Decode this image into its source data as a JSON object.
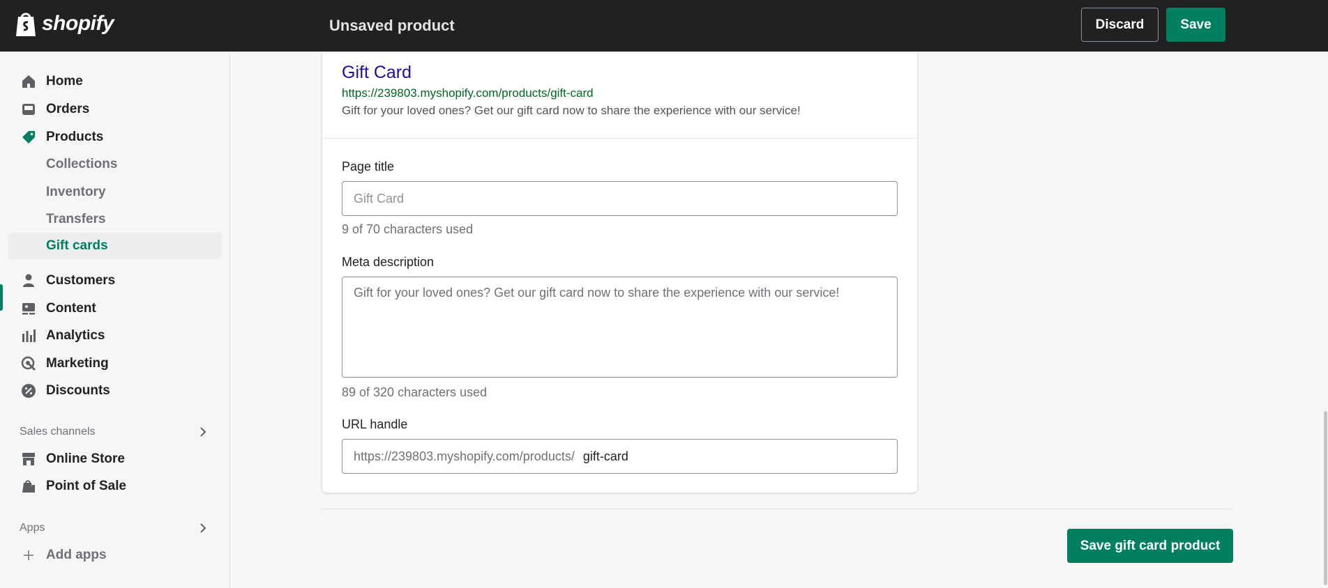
{
  "topbar": {
    "brand": "shopify",
    "page_title": "Unsaved product",
    "discard_label": "Discard",
    "save_label": "Save"
  },
  "sidebar": {
    "items": [
      {
        "label": "Home",
        "icon": "home-icon"
      },
      {
        "label": "Orders",
        "icon": "inbox-icon"
      },
      {
        "label": "Products",
        "icon": "tag-icon"
      },
      {
        "label": "Collections"
      },
      {
        "label": "Inventory"
      },
      {
        "label": "Transfers"
      },
      {
        "label": "Gift cards",
        "active": true
      },
      {
        "label": "Customers",
        "icon": "person-icon"
      },
      {
        "label": "Content",
        "icon": "image-icon"
      },
      {
        "label": "Analytics",
        "icon": "bar-chart-icon"
      },
      {
        "label": "Marketing",
        "icon": "target-icon"
      },
      {
        "label": "Discounts",
        "icon": "discount-icon"
      }
    ],
    "sales_channels_label": "Sales channels",
    "channels": [
      {
        "label": "Online Store",
        "icon": "store-icon"
      },
      {
        "label": "Point of Sale",
        "icon": "pos-icon"
      }
    ],
    "apps_label": "Apps",
    "add_apps_label": "Add apps"
  },
  "seo": {
    "preview": {
      "title": "Gift Card",
      "url": "https://239803.myshopify.com/products/gift-card",
      "description": "Gift for your loved ones? Get our gift card now to share the experience with our service!"
    },
    "page_title_label": "Page title",
    "page_title_placeholder": "Gift Card",
    "page_title_help": "9 of 70 characters used",
    "meta_label": "Meta description",
    "meta_placeholder": "Gift for your loved ones? Get our gift card now to share the experience with our service!",
    "meta_help": "89 of 320 characters used",
    "url_label": "URL handle",
    "url_prefix": "https://239803.myshopify.com/products/",
    "url_value": "gift-card"
  },
  "footer": {
    "save_product_label": "Save gift card product"
  },
  "colors": {
    "accent": "#008060",
    "topbar": "#1f2123",
    "link": "#1a0dab",
    "url_green": "#006621"
  }
}
